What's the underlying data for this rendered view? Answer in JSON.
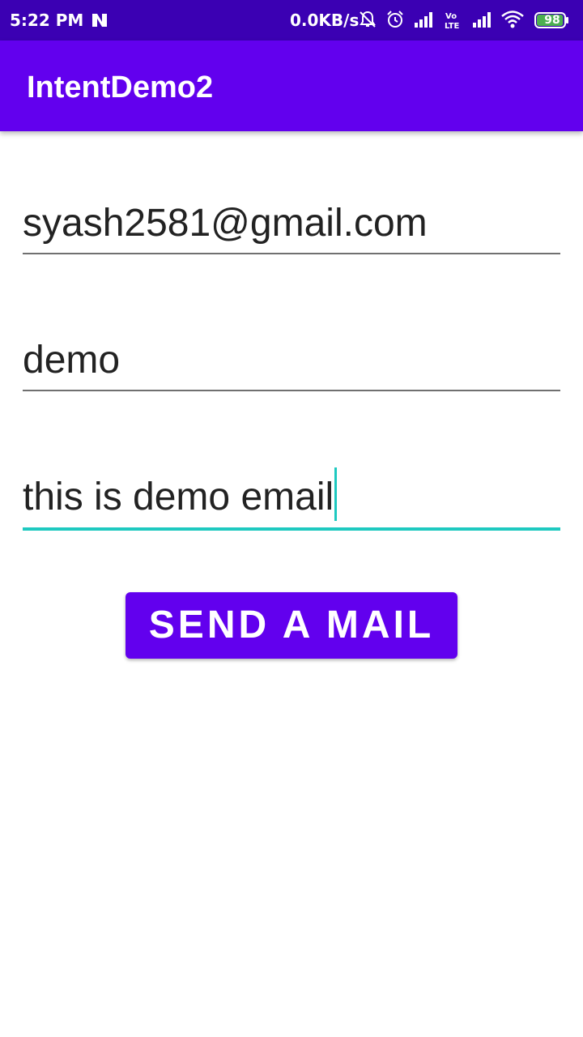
{
  "status_bar": {
    "time": "5:22 PM",
    "network_speed": "0.0KB/s",
    "battery_level": "98",
    "icons": [
      "notification-n-icon",
      "bell-off-icon",
      "alarm-icon",
      "signal-icon",
      "volte-icon",
      "wifi-icon",
      "battery-icon"
    ],
    "colors": {
      "background": "#3b00b3",
      "battery_fill": "#4caf50"
    }
  },
  "app_bar": {
    "title": "IntentDemo2",
    "color": "#6200ee"
  },
  "form": {
    "email_value": "syash2581@gmail.com",
    "subject_value": "demo",
    "message_value": "this is demo email",
    "focus_color": "#1ec9c0"
  },
  "send_button": {
    "label": "SEND A MAIL",
    "color": "#6200ee"
  }
}
